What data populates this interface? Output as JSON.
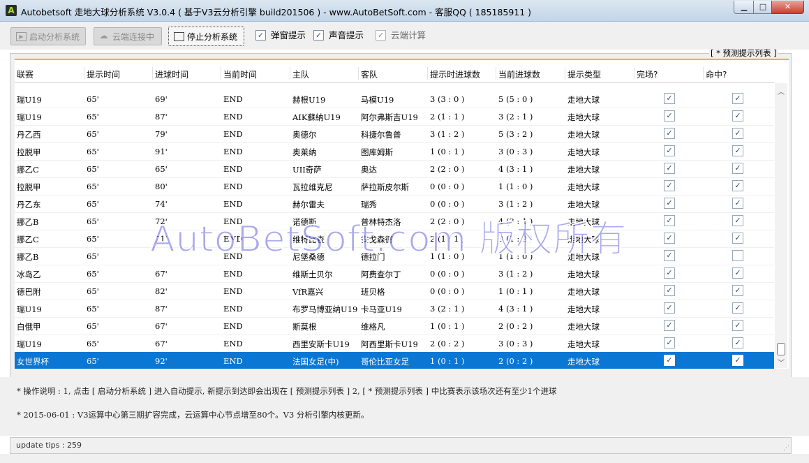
{
  "window": {
    "title": "Autobetsoft 走地大球分析系统 V3.0.4 ( 基于V3云分析引擎 build201506 ) - www.AutoBetSoft.com - 客服QQ ( 185185911 )",
    "icon_letter": "A",
    "min_symbol": "▁",
    "max_symbol": "□",
    "close_symbol": "✕"
  },
  "toolbar": {
    "start_label": "启动分析系统",
    "cloud_label": "云端连接中",
    "stop_label": "停止分析系统",
    "popup_label": "弹窗提示",
    "popup_checked": true,
    "sound_label": "声音提示",
    "sound_checked": true,
    "cloud_calc_label": "云端计算",
    "cloud_calc_checked": true
  },
  "group_title": "[ * 预测提示列表 ]",
  "columns": [
    "联赛",
    "提示时间",
    "进球时间",
    "当前时间",
    "主队",
    "客队",
    "提示时进球数",
    "当前进球数",
    "提示类型",
    "完场?",
    "命中?"
  ],
  "rows": [
    {
      "league": "瑞U19",
      "tip": "65'",
      "goal": "69'",
      "cur": "END",
      "home": "赫根U19",
      "away": "马模U19",
      "tip_score": "3 (3 : 0 )",
      "cur_score": "5 (5 : 0 )",
      "type": "走地大球",
      "done": true,
      "hit": true
    },
    {
      "league": "瑞U19",
      "tip": "65'",
      "goal": "87'",
      "cur": "END",
      "home": "AIK蘇納U19",
      "away": "阿尔弗斯吉U19",
      "tip_score": "2 (1 : 1 )",
      "cur_score": "3 (2 : 1 )",
      "type": "走地大球",
      "done": true,
      "hit": true
    },
    {
      "league": "丹乙西",
      "tip": "65'",
      "goal": "79'",
      "cur": "END",
      "home": "奥德尔",
      "away": "科捷尔鲁普",
      "tip_score": "3 (1 : 2 )",
      "cur_score": "5 (3 : 2 )",
      "type": "走地大球",
      "done": true,
      "hit": true
    },
    {
      "league": "拉脱甲",
      "tip": "65'",
      "goal": "91'",
      "cur": "END",
      "home": "奥莱纳",
      "away": "图库姆斯",
      "tip_score": "1 (0 : 1 )",
      "cur_score": "3 (0 : 3 )",
      "type": "走地大球",
      "done": true,
      "hit": true
    },
    {
      "league": "挪乙C",
      "tip": "65'",
      "goal": "65'",
      "cur": "END",
      "home": "UII奇萨",
      "away": "奥达",
      "tip_score": "2 (2 : 0 )",
      "cur_score": "4 (3 : 1 )",
      "type": "走地大球",
      "done": true,
      "hit": true
    },
    {
      "league": "拉脱甲",
      "tip": "65'",
      "goal": "80'",
      "cur": "END",
      "home": "瓦拉维克尼",
      "away": "萨拉斯皮尔斯",
      "tip_score": "0 (0 : 0 )",
      "cur_score": "1 (1 : 0 )",
      "type": "走地大球",
      "done": true,
      "hit": true
    },
    {
      "league": "丹乙东",
      "tip": "65'",
      "goal": "74'",
      "cur": "END",
      "home": "赫尔雷夫",
      "away": "瑞秀",
      "tip_score": "0 (0 : 0 )",
      "cur_score": "3 (1 : 2 )",
      "type": "走地大球",
      "done": true,
      "hit": true
    },
    {
      "league": "挪乙B",
      "tip": "65'",
      "goal": "72'",
      "cur": "END",
      "home": "诺德斯",
      "away": "普林特杰洛",
      "tip_score": "2 (2 : 0 )",
      "cur_score": "4 (3 : 1 )",
      "type": "走地大球",
      "done": true,
      "hit": true
    },
    {
      "league": "挪乙C",
      "tip": "65'",
      "goal": "71'",
      "cur": "END",
      "home": "维特比查",
      "away": "安戈森德",
      "tip_score": "2 (1 : 1 )",
      "cur_score": "3 (1 : 2 )",
      "type": "走地大球",
      "done": true,
      "hit": true
    },
    {
      "league": "挪乙B",
      "tip": "65'",
      "goal": "",
      "cur": "END",
      "home": "尼堡桑德",
      "away": "德拉门",
      "tip_score": "1 (1 : 0 )",
      "cur_score": "1 (1 : 0 )",
      "type": "走地大球",
      "done": true,
      "hit": false
    },
    {
      "league": "冰岛乙",
      "tip": "65'",
      "goal": "67'",
      "cur": "END",
      "home": "维斯土贝尔",
      "away": "阿费查尔丁",
      "tip_score": "0 (0 : 0 )",
      "cur_score": "3 (1 : 2 )",
      "type": "走地大球",
      "done": true,
      "hit": true
    },
    {
      "league": "德巴附",
      "tip": "65'",
      "goal": "82'",
      "cur": "END",
      "home": "VfR嘉兴",
      "away": "班贝格",
      "tip_score": "0 (0 : 0 )",
      "cur_score": "1 (0 : 1 )",
      "type": "走地大球",
      "done": true,
      "hit": true
    },
    {
      "league": "瑞U19",
      "tip": "65'",
      "goal": "87'",
      "cur": "END",
      "home": "布罗马博亚纳U19",
      "away": "卡马亚U19",
      "tip_score": "3 (2 : 1 )",
      "cur_score": "4 (3 : 1 )",
      "type": "走地大球",
      "done": true,
      "hit": true
    },
    {
      "league": "白俄甲",
      "tip": "65'",
      "goal": "67'",
      "cur": "END",
      "home": "斯莫根",
      "away": "维格凡",
      "tip_score": "1 (0 : 1 )",
      "cur_score": "2 (0 : 2 )",
      "type": "走地大球",
      "done": true,
      "hit": true
    },
    {
      "league": "瑞U19",
      "tip": "65'",
      "goal": "67'",
      "cur": "END",
      "home": "西里安斯卡U19",
      "away": "阿西里斯卡U19",
      "tip_score": "2 (0 : 2 )",
      "cur_score": "3 (0 : 3 )",
      "type": "走地大球",
      "done": true,
      "hit": true
    },
    {
      "league": "女世界杯",
      "tip": "65'",
      "goal": "92'",
      "cur": "END",
      "home": "法国女足(中)",
      "away": "哥伦比亚女足",
      "tip_score": "1 (0 : 1 )",
      "cur_score": "2 (0 : 2 )",
      "type": "走地大球",
      "done": true,
      "hit": true,
      "selected": true
    }
  ],
  "watermark": "AutoBetSoft.com 版权所有",
  "info": {
    "line1": "* 操作说明 : 1, 点击 [ 启动分析系统 ] 进入自动提示, 新提示到达即会出现在 [ 预测提示列表 ] 2, [ * 预测提示列表 ] 中比赛表示该场次还有至少1个进球",
    "line2": "* 2015-06-01 :  V3运算中心第三期扩容完成，云运算中心节点增至80个。V3 分析引擎内核更新。"
  },
  "status": {
    "text": "update tips : 259"
  }
}
